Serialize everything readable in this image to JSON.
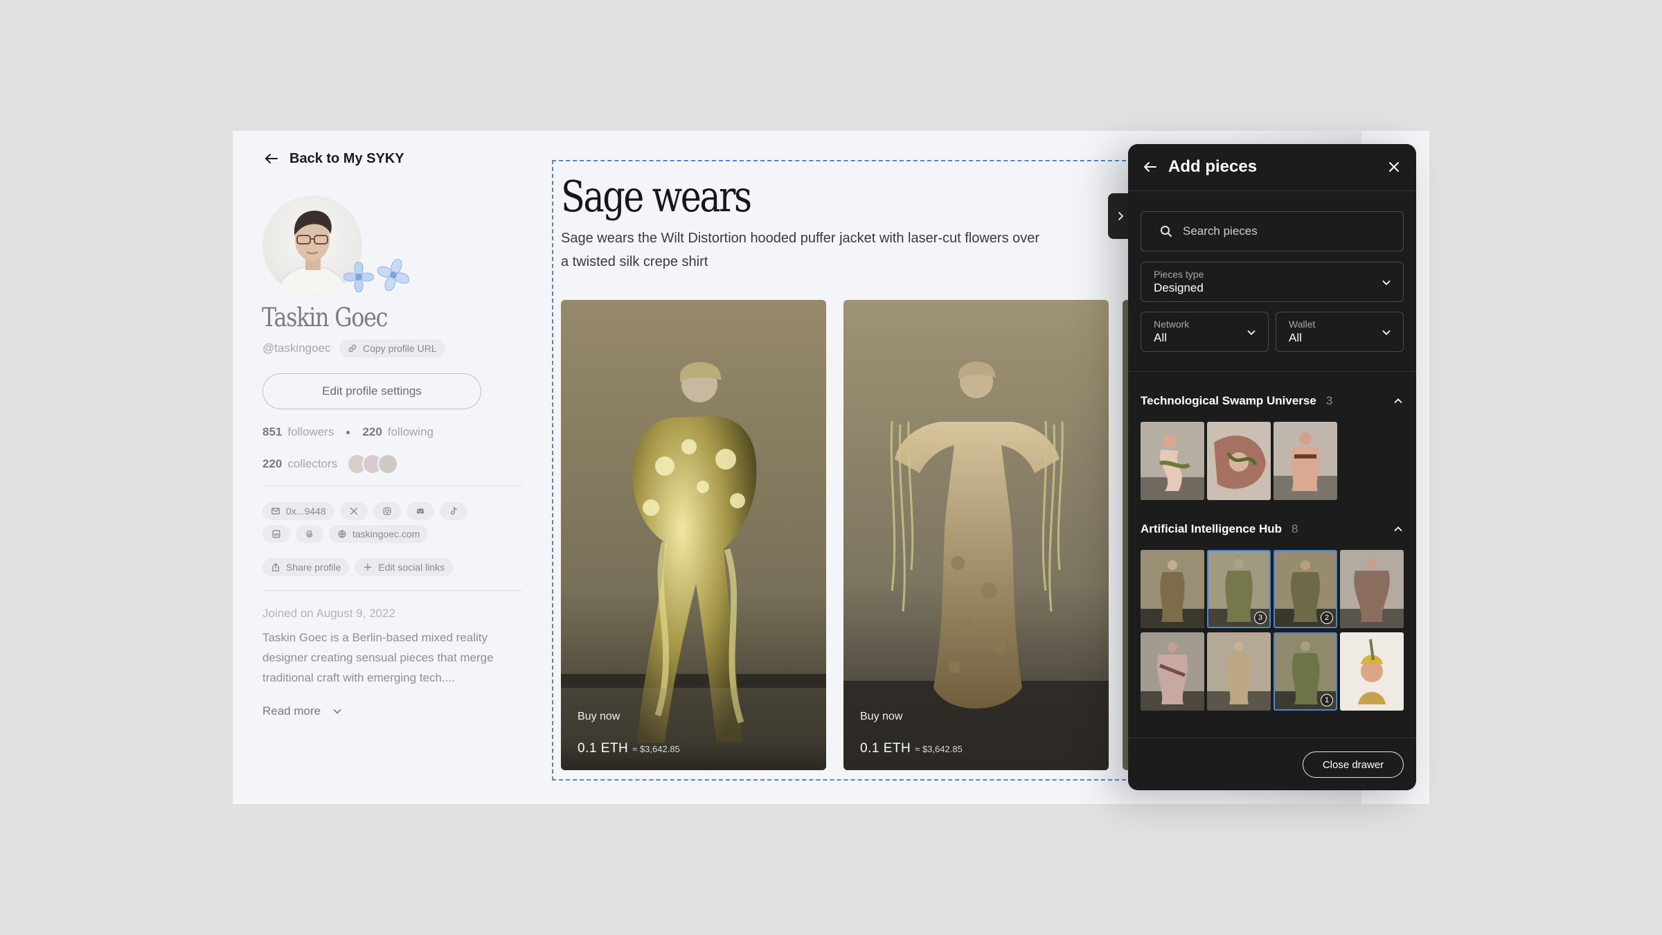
{
  "nav": {
    "back_label": "Back to My SYKY"
  },
  "profile": {
    "name": "Taskin Goec",
    "handle": "@taskingoec",
    "copy_url_label": "Copy profile URL",
    "edit_button": "Edit profile settings",
    "followers_count": "851",
    "followers_label": "followers",
    "following_count": "220",
    "following_label": "following",
    "collectors_count": "220",
    "collectors_label": "collectors",
    "wallet_short": "0x...9448",
    "website": "taskingoec.com",
    "share_label": "Share profile",
    "edit_social_label": "Edit social links",
    "joined": "Joined on August 9, 2022",
    "bio": "Taskin Goec is a Berlin-based mixed reality designer creating sensual pieces that merge traditional craft with emerging tech....",
    "read_more": "Read more"
  },
  "canvas": {
    "title": "Sage wears",
    "description": "Sage wears the Wilt Distortion hooded puffer jacket with laser-cut flowers over a twisted silk crepe shirt",
    "cards": [
      {
        "buy_label": "Buy now",
        "price_eth": "0.1 ETH",
        "price_usd": "≈ $3,642.85"
      },
      {
        "buy_label": "Buy now",
        "price_eth": "0.1 ETH",
        "price_usd": "≈ $3,642.85"
      }
    ]
  },
  "drawer": {
    "title": "Add pieces",
    "search_placeholder": "Search pieces",
    "pieces_type": {
      "label": "Pieces type",
      "value": "Designed"
    },
    "network": {
      "label": "Network",
      "value": "All"
    },
    "wallet": {
      "label": "Wallet",
      "value": "All"
    },
    "groups": [
      {
        "name": "Technological Swamp Universe",
        "count": "3"
      },
      {
        "name": "Artificial Intelligence Hub",
        "count": "8"
      }
    ],
    "selection_badges": [
      "3",
      "2",
      "1"
    ],
    "close_label": "Close drawer"
  },
  "icons": {
    "back": "arrow-left-icon",
    "link": "link-icon",
    "mail": "mail-icon",
    "x": "x-logo-icon",
    "instagram": "instagram-icon",
    "discord": "discord-icon",
    "tiktok": "tiktok-icon",
    "linkedin": "linkedin-icon",
    "threads": "threads-icon",
    "globe": "globe-icon",
    "share": "share-icon",
    "plus": "plus-icon",
    "chevron_down": "chevron-down-icon",
    "chevron_up": "chevron-up-icon",
    "chevron_right": "chevron-right-icon",
    "search": "search-icon",
    "close": "close-icon"
  },
  "colors": {
    "accent": "#4a86d1",
    "drawer_bg": "#1c1c1c",
    "page_bg": "#f3f5f9"
  }
}
